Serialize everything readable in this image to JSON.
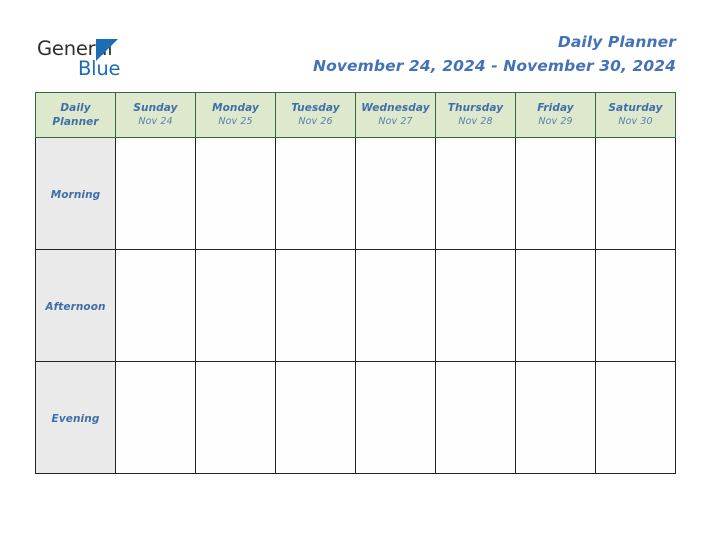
{
  "brand": {
    "name_part1": "General",
    "name_part2": "Blue",
    "triangle_color": "#1c6eb4",
    "text_color": "#2e2e2e"
  },
  "header": {
    "title": "Daily Planner",
    "date_range": "November 24, 2024 - November 30, 2024",
    "title_color": "#4472b8"
  },
  "table": {
    "corner": {
      "line1": "Daily",
      "line2": "Planner"
    },
    "header_bg": "#dde8cc",
    "header_border": "#2f6b3f",
    "header_text_color": "#3f6fa8",
    "row_label_bg": "#eaeaea",
    "cell_border": "#232323",
    "columns": [
      {
        "day": "Sunday",
        "date": "Nov 24"
      },
      {
        "day": "Monday",
        "date": "Nov 25"
      },
      {
        "day": "Tuesday",
        "date": "Nov 26"
      },
      {
        "day": "Wednesday",
        "date": "Nov 27"
      },
      {
        "day": "Thursday",
        "date": "Nov 28"
      },
      {
        "day": "Friday",
        "date": "Nov 29"
      },
      {
        "day": "Saturday",
        "date": "Nov 30"
      }
    ],
    "rows": [
      {
        "label": "Morning",
        "cells": [
          "",
          "",
          "",
          "",
          "",
          "",
          ""
        ]
      },
      {
        "label": "Afternoon",
        "cells": [
          "",
          "",
          "",
          "",
          "",
          "",
          ""
        ]
      },
      {
        "label": "Evening",
        "cells": [
          "",
          "",
          "",
          "",
          "",
          "",
          ""
        ]
      }
    ]
  }
}
